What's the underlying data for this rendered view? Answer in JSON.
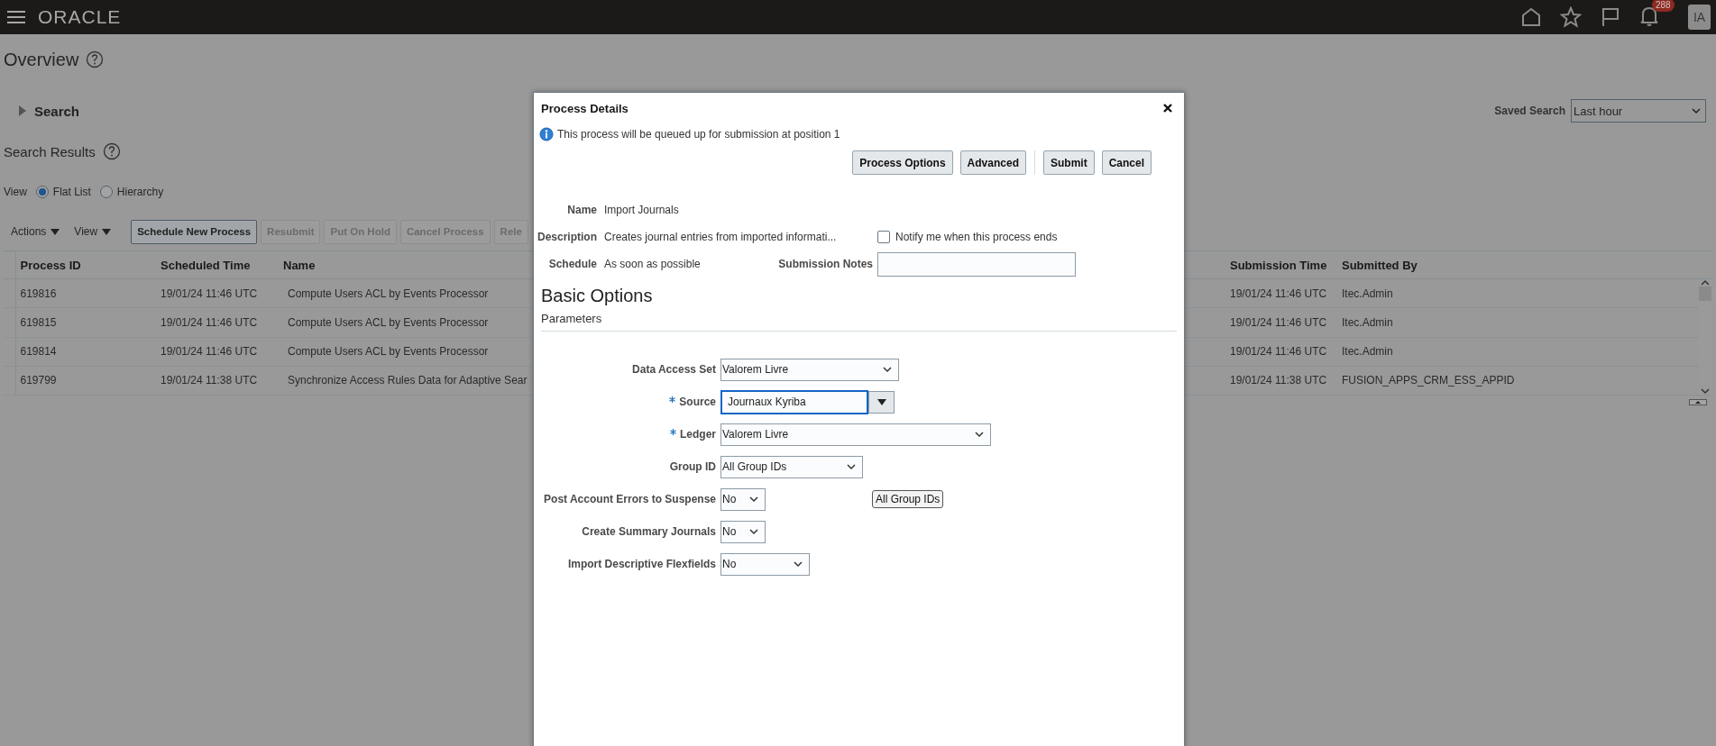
{
  "top_bar": {
    "logo": "ORACLE",
    "notifications_count": "288",
    "avatar_initials": "IA"
  },
  "page": {
    "title": "Overview",
    "search": {
      "label": "Search",
      "expanded": false
    },
    "saved_search": {
      "label": "Saved Search",
      "value": "Last hour"
    },
    "results_title": "Search Results",
    "view": {
      "label": "View",
      "options": [
        {
          "label": "Flat List",
          "selected": true
        },
        {
          "label": "Hierarchy",
          "selected": false
        }
      ]
    },
    "toolbar": {
      "menus": [
        "Actions",
        "View"
      ],
      "buttons": [
        {
          "label": "Schedule New Process",
          "disabled": false
        },
        {
          "label": "Resubmit",
          "disabled": true
        },
        {
          "label": "Put On Hold",
          "disabled": true
        },
        {
          "label": "Cancel Process",
          "disabled": true
        },
        {
          "label": "Rele",
          "disabled": true
        }
      ]
    },
    "table": {
      "columns": [
        "Process ID",
        "Scheduled Time",
        "Name",
        "Submission Time",
        "Submitted By"
      ],
      "rows": [
        {
          "cells": [
            "619816",
            "19/01/24 11:46 UTC",
            "Compute Users ACL by Events Processor",
            "19/01/24 11:46 UTC",
            "Itec.Admin"
          ]
        },
        {
          "cells": [
            "619815",
            "19/01/24 11:46 UTC",
            "Compute Users ACL by Events Processor",
            "19/01/24 11:46 UTC",
            "Itec.Admin"
          ]
        },
        {
          "cells": [
            "619814",
            "19/01/24 11:46 UTC",
            "Compute Users ACL by Events Processor",
            "19/01/24 11:46 UTC",
            "Itec.Admin"
          ]
        },
        {
          "cells": [
            "619799",
            "19/01/24 11:38 UTC",
            "Synchronize Access Rules Data for Adaptive Sear",
            "19/01/24 11:38 UTC",
            "FUSION_APPS_CRM_ESS_APPID"
          ]
        }
      ]
    }
  },
  "dialog": {
    "title": "Process Details",
    "info": "This process will be queued up for submission at position 1",
    "buttons": [
      {
        "label": "Process Options"
      },
      {
        "label": "Advanced"
      },
      {
        "label": "Submit"
      },
      {
        "label": "Cancel"
      }
    ],
    "details": [
      {
        "label": "Name",
        "value": "Import Journals"
      },
      {
        "label": "Description",
        "value": "Creates journal entries from imported informati..."
      },
      {
        "label": "Schedule",
        "value": "As soon as possible"
      }
    ],
    "notify": {
      "label": "Notify me when this process ends",
      "checked": false
    },
    "submission_notes": {
      "label": "Submission Notes"
    },
    "section_title": "Basic Options",
    "subsection_title": "Parameters",
    "parameters": [
      {
        "label": "Data Access Set",
        "kind": "select",
        "value": "Valorem Livre",
        "required": false
      },
      {
        "label": "Source",
        "kind": "combo",
        "value": "Journaux Kyriba",
        "required": true,
        "focused": true
      },
      {
        "label": "Ledger",
        "kind": "select",
        "value": "Valorem Livre",
        "required": true
      },
      {
        "label": "Group ID",
        "kind": "select",
        "value": "All Group IDs",
        "required": false
      },
      {
        "label": "Post Account Errors to Suspense",
        "kind": "select",
        "value": "No",
        "required": false,
        "side_button": "All Group IDs"
      },
      {
        "label": "Create Summary Journals",
        "kind": "select",
        "value": "No",
        "required": false
      },
      {
        "label": "Import Descriptive Flexfields",
        "kind": "select",
        "value": "No",
        "required": false
      }
    ]
  }
}
